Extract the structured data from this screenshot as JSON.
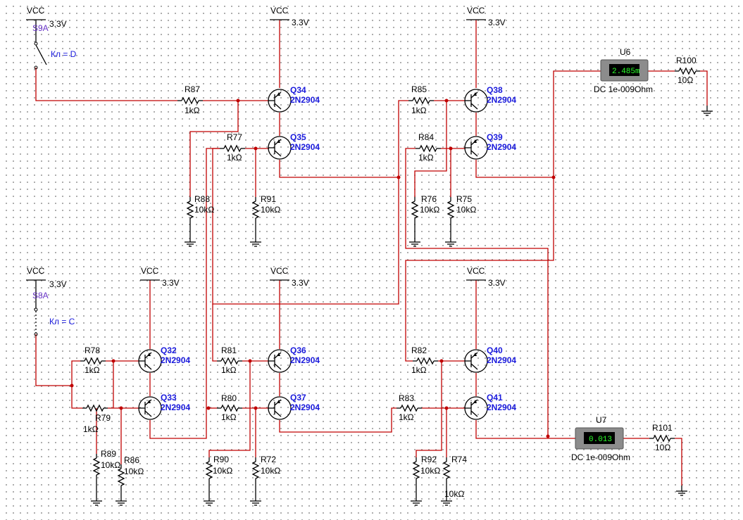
{
  "labels": {
    "vcc": "VCC",
    "v33": "3.3V",
    "switches": [
      {
        "name": "S9A",
        "key": "Кл = D"
      },
      {
        "name": "S8A",
        "key": "Кл = C"
      }
    ],
    "transistor_model": "2N2904",
    "transistors": [
      "Q34",
      "Q35",
      "Q38",
      "Q39",
      "Q32",
      "Q33",
      "Q36",
      "Q37",
      "Q40",
      "Q41"
    ],
    "resistors": {
      "R87": {
        "name": "R87",
        "value": "1kΩ"
      },
      "R77": {
        "name": "R77",
        "value": "1kΩ"
      },
      "R88": {
        "name": "R88",
        "value": "10kΩ"
      },
      "R91": {
        "name": "R91",
        "value": "10kΩ"
      },
      "R85": {
        "name": "R85",
        "value": "1kΩ"
      },
      "R84": {
        "name": "R84",
        "value": "1kΩ"
      },
      "R76": {
        "name": "R76",
        "value": "10kΩ"
      },
      "R75": {
        "name": "R75",
        "value": "10kΩ"
      },
      "R100": {
        "name": "R100",
        "value": "10Ω"
      },
      "R78": {
        "name": "R78",
        "value": "1kΩ"
      },
      "R79": {
        "name": "R79",
        "value": "1kΩ"
      },
      "R89": {
        "name": "R89",
        "value": "10kΩ"
      },
      "R86": {
        "name": "R86",
        "value": "10kΩ"
      },
      "R81": {
        "name": "R81",
        "value": "1kΩ"
      },
      "R80": {
        "name": "R80",
        "value": "1kΩ"
      },
      "R90": {
        "name": "R90",
        "value": "10kΩ"
      },
      "R72": {
        "name": "R72",
        "value": "10kΩ"
      },
      "R82": {
        "name": "R82",
        "value": "1kΩ"
      },
      "R83": {
        "name": "R83",
        "value": "1kΩ"
      },
      "R92": {
        "name": "R92",
        "value": "10kΩ"
      },
      "R74": {
        "name": "R74",
        "value": "10kΩ"
      },
      "R101": {
        "name": "R101",
        "value": "10Ω"
      }
    },
    "meters": [
      {
        "name": "U6",
        "reading": "2.485m",
        "mode": "DC  1e-009Ohm"
      },
      {
        "name": "U7",
        "reading": "0.013",
        "mode": "DC  1e-009Ohm"
      }
    ]
  },
  "colors": {
    "wire": "#c00000",
    "component": "#000000",
    "label_blue": "#1a1adc",
    "label_purple": "#6a36c8",
    "meter_display": "#2aff2a"
  }
}
